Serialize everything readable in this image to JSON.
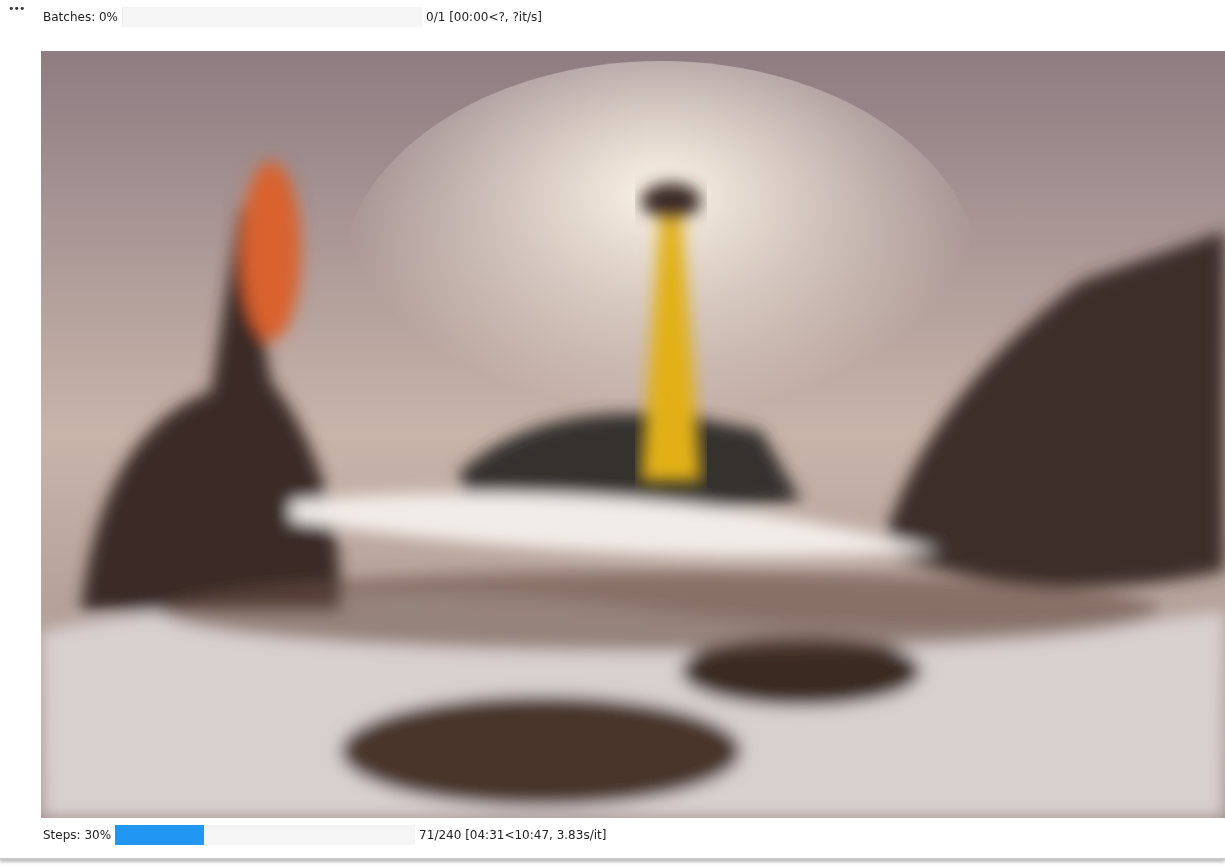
{
  "menu_glyph": "•••",
  "progress_bars": [
    {
      "label": "Batches: 0%",
      "level": 0,
      "reading": "0/1 [00:00<?, ?it/s]"
    }
  ],
  "bottom_progress": {
    "label": "Steps: 30%",
    "level": 0.2958,
    "reading": "71/240 [04:31<10:47, 3.83s/it]"
  }
}
